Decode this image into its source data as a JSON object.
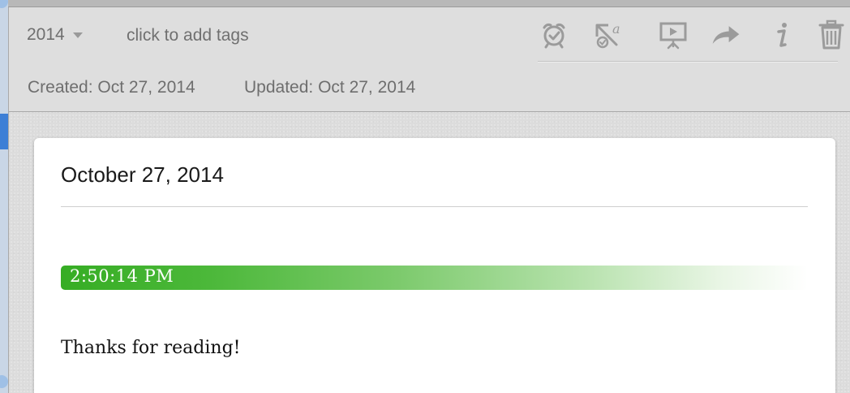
{
  "header": {
    "notebook": "2014",
    "tags_placeholder": "click to add tags",
    "created": "Created: Oct 27, 2014",
    "updated": "Updated: Oct 27, 2014"
  },
  "toolbar": {
    "icons": [
      "alarm-clock-icon",
      "annotate-icon",
      "presentation-icon",
      "share-icon",
      "info-icon",
      "trash-icon"
    ],
    "icon_color": "#9b9b9b"
  },
  "note": {
    "title": "October 27, 2014",
    "time_label": "2:50:14 PM",
    "body": "Thanks for reading!"
  },
  "colors": {
    "accent_green": "#36ad24",
    "selection_blue": "#3d7fd6",
    "header_bg": "#dedede"
  }
}
